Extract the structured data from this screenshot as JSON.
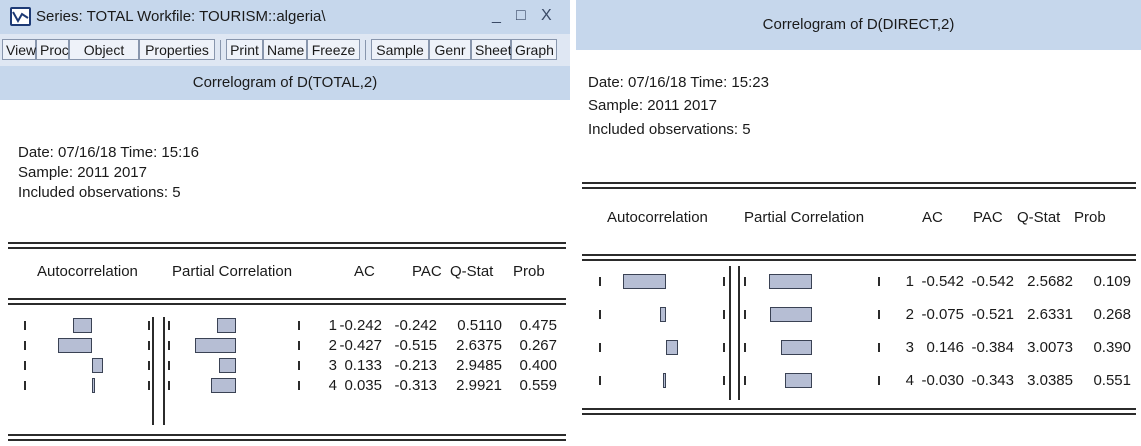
{
  "left": {
    "window_title": "Series: TOTAL   Workfile: TOURISM::algeria\\",
    "window_controls": {
      "minimize": "_",
      "maximize": "□",
      "close": "X"
    },
    "toolbar": [
      "View",
      "Proc",
      "Object",
      "Properties",
      "Print",
      "Name",
      "Freeze",
      "Sample",
      "Genr",
      "Sheet",
      "Graph"
    ],
    "panel_title": "Correlogram of D(TOTAL,2)",
    "info": {
      "date_line": "Date: 07/16/18   Time: 15:16",
      "sample_line": "Sample: 2011 2017",
      "obs_line": "Included observations: 5"
    },
    "headers": {
      "autocorrelation": "Autocorrelation",
      "partial": "Partial Correlation",
      "ac": "AC",
      "pac": "PAC",
      "qstat": "Q-Stat",
      "prob": "Prob"
    },
    "rows": [
      {
        "lag": "1",
        "ac": "-0.242",
        "pac": "-0.242",
        "qstat": "0.5110",
        "prob": "0.475"
      },
      {
        "lag": "2",
        "ac": "-0.427",
        "pac": "-0.515",
        "qstat": "2.6375",
        "prob": "0.267"
      },
      {
        "lag": "3",
        "ac": "0.133",
        "pac": "-0.213",
        "qstat": "2.9485",
        "prob": "0.400"
      },
      {
        "lag": "4",
        "ac": "0.035",
        "pac": "-0.313",
        "qstat": "2.9921",
        "prob": "0.559"
      }
    ]
  },
  "right": {
    "panel_title": "Correlogram of D(DIRECT,2)",
    "info": {
      "date_line": "Date: 07/16/18   Time: 15:23",
      "sample_line": "Sample: 2011 2017",
      "obs_line": "Included observations: 5"
    },
    "headers": {
      "autocorrelation": "Autocorrelation",
      "partial": "Partial Correlation",
      "ac": "AC",
      "pac": "PAC",
      "qstat": "Q-Stat",
      "prob": "Prob"
    },
    "rows": [
      {
        "lag": "1",
        "ac": "-0.542",
        "pac": "-0.542",
        "qstat": "2.5682",
        "prob": "0.109"
      },
      {
        "lag": "2",
        "ac": "-0.075",
        "pac": "-0.521",
        "qstat": "2.6331",
        "prob": "0.268"
      },
      {
        "lag": "3",
        "ac": "0.146",
        "pac": "-0.384",
        "qstat": "3.0073",
        "prob": "0.390"
      },
      {
        "lag": "4",
        "ac": "-0.030",
        "pac": "-0.343",
        "qstat": "3.0385",
        "prob": "0.551"
      }
    ]
  },
  "colors": {
    "titlebar": "#c6d7ec",
    "toolbar": "#dfe7f3",
    "bar_fill": "#b6bed4",
    "bar_border": "#3a4254"
  }
}
